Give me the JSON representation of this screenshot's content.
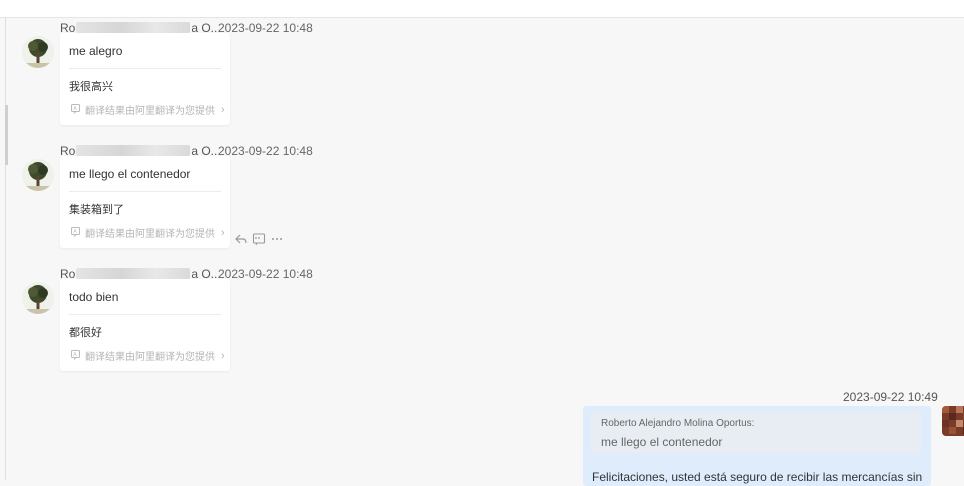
{
  "messages": [
    {
      "sender_visible_start": "Ro",
      "sender_visible_end": "a O...",
      "time": "2023-09-22 10:48",
      "original": "me alegro",
      "translation": "我很高兴",
      "credit": "翻译结果由阿里翻译为您提供"
    },
    {
      "sender_visible_start": "Ro",
      "sender_visible_end": "a O...",
      "time": "2023-09-22 10:48",
      "original": "me llego el contenedor",
      "translation": "集装箱到了",
      "credit": "翻译结果由阿里翻译为您提供"
    },
    {
      "sender_visible_start": "Ro",
      "sender_visible_end": "a O...",
      "time": "2023-09-22 10:48",
      "original": "todo bien",
      "translation": "都很好",
      "credit": "翻译结果由阿里翻译为您提供"
    }
  ],
  "reply": {
    "time": "2023-09-22 10:49",
    "quote_name": "Roberto Alejandro Molina Oportus:",
    "quote_text": "me llego el contenedor",
    "body": "Felicitaciones, usted está seguro de recibir las mercancías sin"
  },
  "icons": {
    "translate": "translate-icon",
    "reply": "reply-icon",
    "quote": "quote-icon",
    "more": "more-icon"
  },
  "colors": {
    "page_bg": "#f7f7f7",
    "bubble_bg": "#ffffff",
    "my_bubble_bg": "#dfecfb",
    "quote_bg": "#e8edf3"
  }
}
